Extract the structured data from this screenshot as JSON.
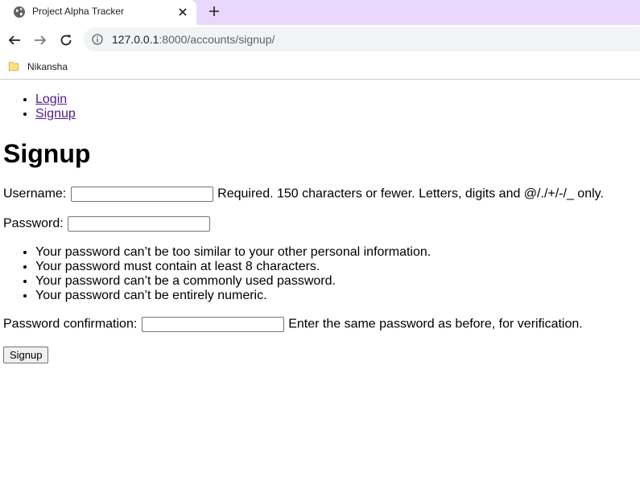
{
  "browser": {
    "tab_title": "Project Alpha Tracker",
    "url_host": "127.0.0.1",
    "url_rest": ":8000/accounts/signup/",
    "bookmark_label": "Nikansha"
  },
  "nav": {
    "links": [
      {
        "label": "Login"
      },
      {
        "label": "Signup"
      }
    ]
  },
  "form": {
    "heading": "Signup",
    "username_label": "Username:",
    "username_value": "",
    "username_help": "Required. 150 characters or fewer. Letters, digits and @/./+/-/_ only.",
    "password_label": "Password:",
    "password_value": "",
    "password_rules": [
      "Your password can’t be too similar to your other personal information.",
      "Your password must contain at least 8 characters.",
      "Your password can’t be a commonly used password.",
      "Your password can’t be entirely numeric."
    ],
    "confirm_label": "Password confirmation:",
    "confirm_value": "",
    "confirm_help": "Enter the same password as before, for verification.",
    "submit_label": "Signup"
  }
}
